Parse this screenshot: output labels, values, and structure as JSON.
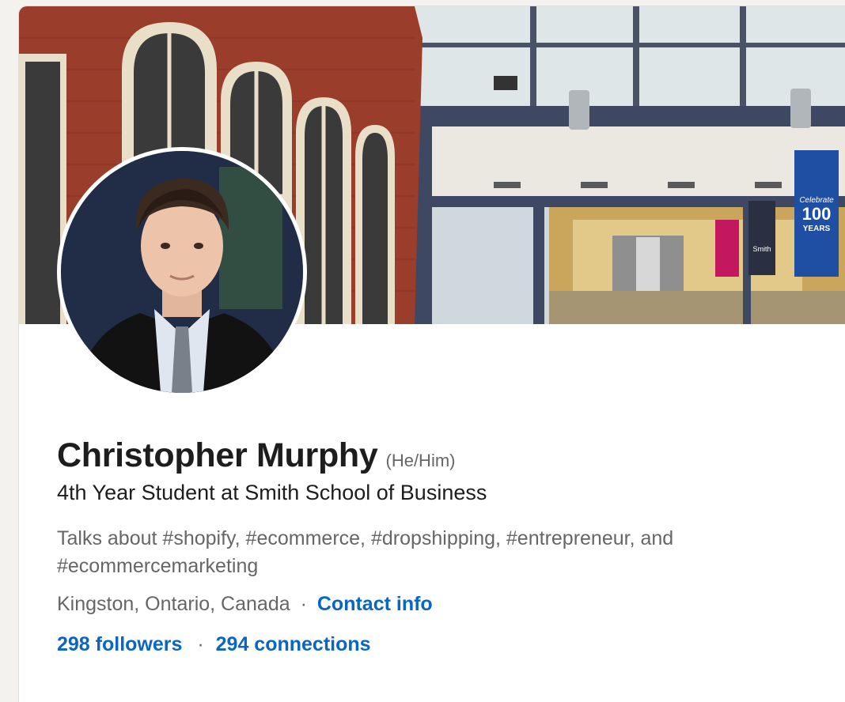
{
  "profile": {
    "name": "Christopher Murphy",
    "pronouns": "(He/Him)",
    "headline": "4th Year Student at Smith School of Business",
    "talks_about": "Talks about #shopify, #ecommerce, #dropshipping, #entrepreneur, and #ecommercemarketing",
    "location": "Kingston, Ontario, Canada",
    "separator": "·",
    "contact_info_label": "Contact info",
    "followers_label": "298 followers",
    "connections_label": "294 connections"
  },
  "banner": {
    "banner_text_small": "Celebrate",
    "banner_text_big": "100",
    "banner_text_years": "YEARS",
    "sign_text": "Smith"
  },
  "colors": {
    "link": "#0a66c2",
    "primary_text": "#1d1d1d",
    "secondary_text": "#666666"
  }
}
